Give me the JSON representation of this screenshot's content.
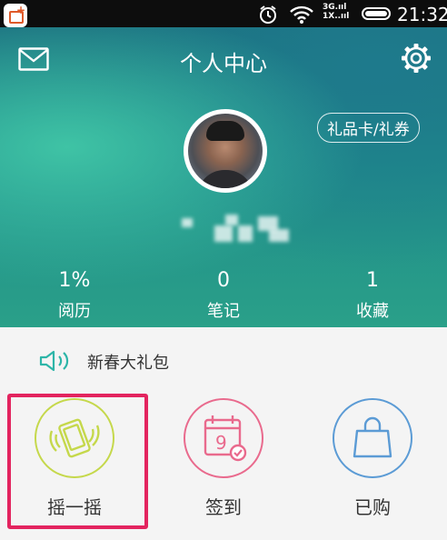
{
  "status_bar": {
    "network_top": "3G.ııl",
    "network_bottom": "1X..ııl",
    "time": "21:32",
    "icons": [
      "app-icon",
      "alarm-icon",
      "wifi-icon",
      "signal-icon",
      "battery-icon"
    ]
  },
  "header": {
    "title": "个人中心",
    "gift_card_label": "礼品卡/礼券",
    "mail_icon": "mail-icon",
    "settings_icon": "gear-icon",
    "accent": "#1e8a8a"
  },
  "stats": [
    {
      "value": "1%",
      "label": "阅历"
    },
    {
      "value": "0",
      "label": "笔记"
    },
    {
      "value": "1",
      "label": "收藏"
    }
  ],
  "promo": {
    "icon": "speaker-icon",
    "text": "新春大礼包"
  },
  "actions": [
    {
      "label": "摇一摇",
      "icon": "shake-phone-icon",
      "color": "#c5d84b"
    },
    {
      "label": "签到",
      "icon": "calendar-checkin-icon",
      "color": "#e96a8d",
      "calendar_day": "9"
    },
    {
      "label": "已购",
      "icon": "shopping-bag-icon",
      "color": "#5b9bd5"
    }
  ],
  "highlight_color": "#e3245f"
}
